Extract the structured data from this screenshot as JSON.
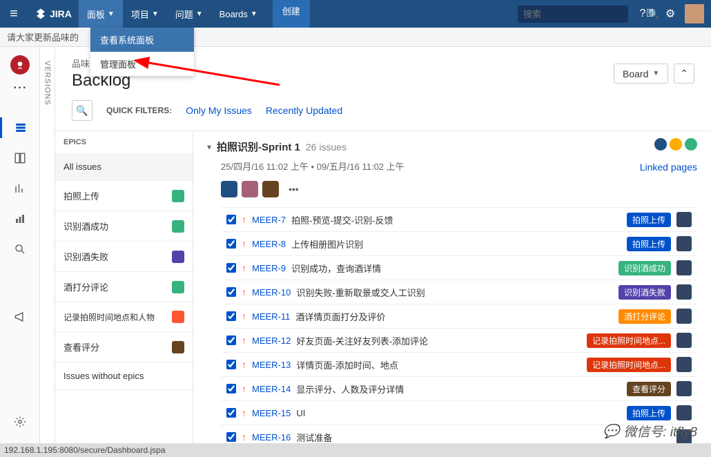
{
  "topnav": {
    "logo_text": "JIRA",
    "items": [
      "面板",
      "项目",
      "问题",
      "Boards"
    ],
    "active_index": 0,
    "create_label": "创建",
    "search_placeholder": "搜索"
  },
  "dropdown": {
    "items": [
      "查看系统面板",
      "管理面板"
    ],
    "highlighted_index": 0
  },
  "banner_text": "请大家更新品味的",
  "leftrail": {
    "icons": [
      {
        "name": "backlog-icon",
        "active": true
      },
      {
        "name": "board-icon",
        "active": false
      },
      {
        "name": "chart-icon",
        "active": false
      },
      {
        "name": "reports-icon",
        "active": false
      },
      {
        "name": "search-icon",
        "active": false
      }
    ],
    "announce": "announce-icon"
  },
  "versions_label": "VERSIONS",
  "breadcrumb": "品味",
  "page_title": "Backlog",
  "board_button": "Board",
  "filters": {
    "label": "QUICK FILTERS:",
    "items": [
      "Only My Issues",
      "Recently Updated"
    ]
  },
  "epics": {
    "header": "EPICS",
    "items": [
      {
        "label": "All issues",
        "color": null,
        "active": true
      },
      {
        "label": "拍照上传",
        "color": "#36B37E"
      },
      {
        "label": "识别酒成功",
        "color": "#36B37E"
      },
      {
        "label": "识别酒失败",
        "color": "#5243AA"
      },
      {
        "label": "酒打分评论",
        "color": "#36B37E"
      },
      {
        "label": "记录拍照时间地点和人物",
        "color": "#FF5630"
      },
      {
        "label": "查看评分",
        "color": "#654321"
      },
      {
        "label": "Issues without epics",
        "color": null
      }
    ]
  },
  "sprint": {
    "name": "拍照识别-Sprint 1",
    "count_label": "26 issues",
    "date_range": "25/四月/16 11:02 上午 • 09/五月/16 11:02 上午",
    "linked_pages": "Linked pages",
    "status_colors": [
      "#205081",
      "#FFAB00",
      "#36B37E"
    ],
    "filter_swatches": [
      "#205081",
      "#A5607A",
      "#654321"
    ]
  },
  "issues": [
    {
      "key": "MEER-7",
      "summary": "拍照-预览-提交-识别-反馈",
      "epic": "拍照上传",
      "epic_color": "#0052cc"
    },
    {
      "key": "MEER-8",
      "summary": "上传相册图片识别",
      "epic": "拍照上传",
      "epic_color": "#0052cc"
    },
    {
      "key": "MEER-9",
      "summary": "识别成功，查询酒详情",
      "epic": "识别酒成功",
      "epic_color": "#36B37E"
    },
    {
      "key": "MEER-10",
      "summary": "识别失败-重新取景或交人工识别",
      "epic": "识别酒失败",
      "epic_color": "#5243AA"
    },
    {
      "key": "MEER-11",
      "summary": "酒详情页面打分及评价",
      "epic": "酒打分评论",
      "epic_color": "#FF8B00"
    },
    {
      "key": "MEER-12",
      "summary": "好友页面-关注好友列表-添加评论",
      "epic": "记录拍照时间地点...",
      "epic_color": "#DE350B"
    },
    {
      "key": "MEER-13",
      "summary": "详情页面-添加时间、地点",
      "epic": "记录拍照时间地点...",
      "epic_color": "#DE350B"
    },
    {
      "key": "MEER-14",
      "summary": "显示评分、人数及评分详情",
      "epic": "查看评分",
      "epic_color": "#654321"
    },
    {
      "key": "MEER-15",
      "summary": "UI",
      "epic": "拍照上传",
      "epic_color": "#0052cc"
    },
    {
      "key": "MEER-16",
      "summary": "测试准备",
      "epic": "",
      "epic_color": ""
    }
  ],
  "statusbar_text": "192.168.1.195:8080/secure/Dashboard.jspa",
  "watermark": "微信号: itfly8"
}
